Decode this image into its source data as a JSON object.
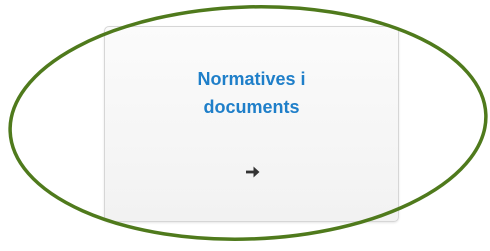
{
  "card": {
    "title_line1": "Normatives i",
    "title_line2": "documents"
  },
  "icons": {
    "arrow": "arrow-right-icon"
  },
  "colors": {
    "title": "#1f7fc9",
    "highlight": "#4f7a1c"
  }
}
